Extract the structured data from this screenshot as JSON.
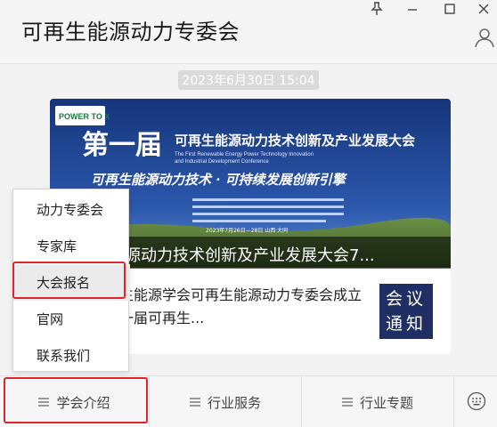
{
  "header": {
    "title": "可再生能源动力专委会"
  },
  "message": {
    "timestamp": "2023年6月30日 15:04",
    "banner_caption": "可再生能源动力技术创新及产业发展大会7...",
    "summary": "中国可再生能源学会可再生能源动力专委会成立大会暨第一届可再生...",
    "thumb_text": [
      "会议",
      "通知"
    ],
    "banner_text": {
      "logo": "POWER TO X",
      "edition": "第一届",
      "conference_cn": "可再生能源动力技术创新及产业发展大会",
      "conference_en_1": "The First Renewable Energy Power Technology Innovation",
      "conference_en_2": "and Industrial Development Conference",
      "slogan": "可再生能源动力技术 · 可持续发展创新引擎",
      "date_line": "2023年7月26日—28日  山西·大同"
    }
  },
  "popup_menu": {
    "items": [
      "动力专委会",
      "专家库",
      "大会报名",
      "官网",
      "联系我们"
    ],
    "highlighted_index": 2
  },
  "bottom_menu": {
    "tabs": [
      "学会介绍",
      "行业服务",
      "行业专题"
    ]
  },
  "colors": {
    "highlight_border": "#e0242a",
    "banner_sky": "#1b3c86",
    "banner_grass": "#5a7d3a"
  }
}
